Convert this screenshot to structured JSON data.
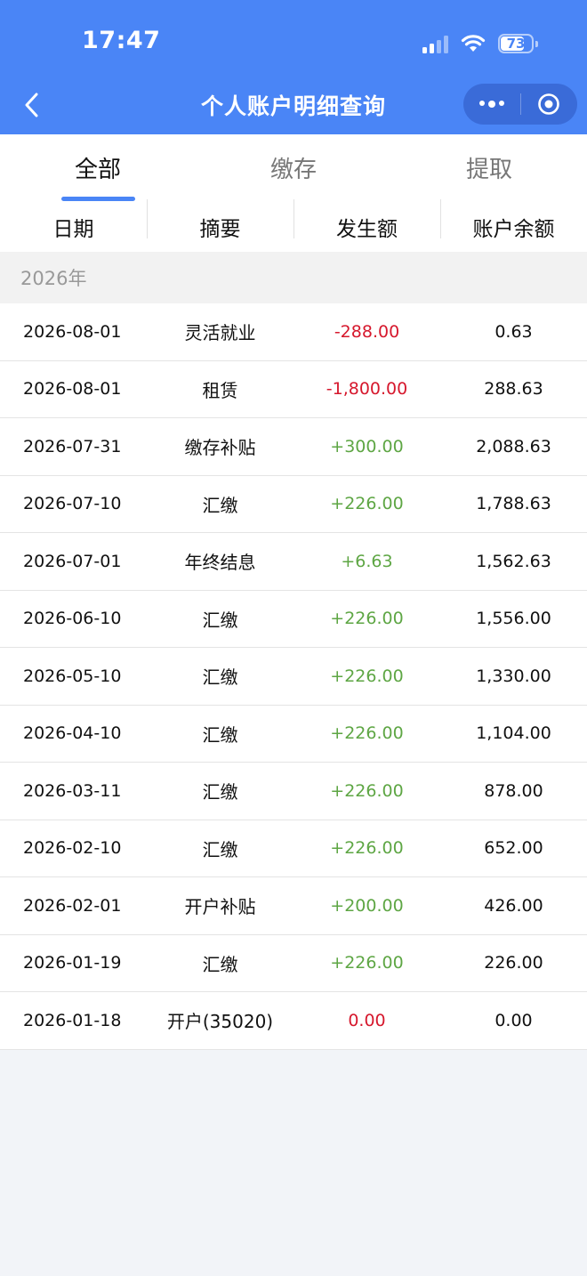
{
  "status_bar": {
    "time": "17:47",
    "battery": "73"
  },
  "nav": {
    "title": "个人账户明细查询"
  },
  "tabs": [
    {
      "label": "全部",
      "active": true
    },
    {
      "label": "缴存",
      "active": false
    },
    {
      "label": "提取",
      "active": false
    }
  ],
  "columns": [
    "日期",
    "摘要",
    "发生额",
    "账户余额"
  ],
  "year_label": "2026年",
  "colors": {
    "header": "#4a85f6",
    "negative": "#d6182d",
    "positive": "#5ea644"
  },
  "rows": [
    {
      "date": "2026-08-01",
      "summary": "灵活就业",
      "amount": "-288.00",
      "sign": "neg",
      "balance": "0.63"
    },
    {
      "date": "2026-08-01",
      "summary": "租赁",
      "amount": "-1,800.00",
      "sign": "neg",
      "balance": "288.63"
    },
    {
      "date": "2026-07-31",
      "summary": "缴存补贴",
      "amount": "+300.00",
      "sign": "pos",
      "balance": "2,088.63"
    },
    {
      "date": "2026-07-10",
      "summary": "汇缴",
      "amount": "+226.00",
      "sign": "pos",
      "balance": "1,788.63"
    },
    {
      "date": "2026-07-01",
      "summary": "年终结息",
      "amount": "+6.63",
      "sign": "pos",
      "balance": "1,562.63"
    },
    {
      "date": "2026-06-10",
      "summary": "汇缴",
      "amount": "+226.00",
      "sign": "pos",
      "balance": "1,556.00"
    },
    {
      "date": "2026-05-10",
      "summary": "汇缴",
      "amount": "+226.00",
      "sign": "pos",
      "balance": "1,330.00"
    },
    {
      "date": "2026-04-10",
      "summary": "汇缴",
      "amount": "+226.00",
      "sign": "pos",
      "balance": "1,104.00"
    },
    {
      "date": "2026-03-11",
      "summary": "汇缴",
      "amount": "+226.00",
      "sign": "pos",
      "balance": "878.00"
    },
    {
      "date": "2026-02-10",
      "summary": "汇缴",
      "amount": "+226.00",
      "sign": "pos",
      "balance": "652.00"
    },
    {
      "date": "2026-02-01",
      "summary": "开户补贴",
      "amount": "+200.00",
      "sign": "pos",
      "balance": "426.00"
    },
    {
      "date": "2026-01-19",
      "summary": "汇缴",
      "amount": "+226.00",
      "sign": "pos",
      "balance": "226.00"
    },
    {
      "date": "2026-01-18",
      "summary": "开户(35020)",
      "amount": "0.00",
      "sign": "neg",
      "balance": "0.00"
    }
  ]
}
